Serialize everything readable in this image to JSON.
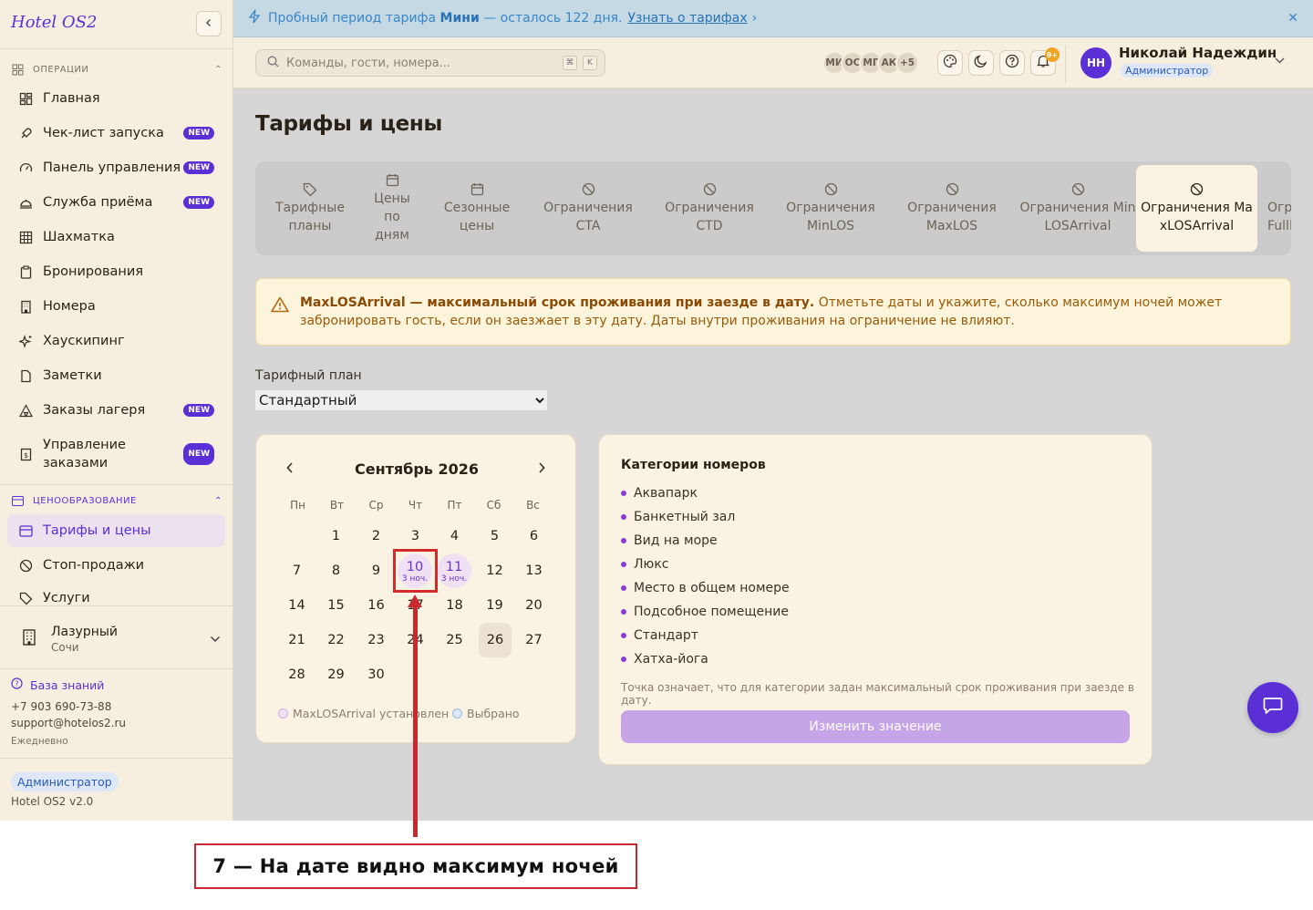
{
  "sidebar": {
    "logo": "Hotel OS2",
    "sections": {
      "operations": "ОПЕРАЦИИ",
      "pricing": "ЦЕНООБРАЗОВАНИЕ"
    },
    "items": [
      {
        "label": "Главная"
      },
      {
        "label": "Чек-лист запуска",
        "badge": "NEW"
      },
      {
        "label": "Панель управления",
        "badge": "NEW"
      },
      {
        "label": "Служба приёма",
        "badge": "NEW"
      },
      {
        "label": "Шахматка"
      },
      {
        "label": "Бронирования"
      },
      {
        "label": "Номера"
      },
      {
        "label": "Хаускипинг"
      },
      {
        "label": "Заметки"
      },
      {
        "label": "Заказы лагеря",
        "badge": "NEW"
      },
      {
        "label": "Управление заказами",
        "badge": "NEW"
      }
    ],
    "pricing_items": [
      {
        "label": "Тарифы и цены"
      },
      {
        "label": "Стоп-продажи"
      },
      {
        "label": "Услуги"
      }
    ],
    "hotel": {
      "name": "Лазурный",
      "city": "Сочи"
    },
    "kb": "База знаний",
    "phone": "+7 903 690-73-88",
    "email": "support@hotelos2.ru",
    "hours": "Ежедневно",
    "role": "Администратор",
    "version": "Hotel OS2 v2.0"
  },
  "banner": {
    "text_pre": "Пробный период тарифа",
    "plan": "Мини",
    "text_post": "— осталось 122 дня.",
    "link": "Узнать о тарифах",
    "link_arrow": "›",
    "close": "✕"
  },
  "topbar": {
    "search_placeholder": "Команды, гости, номера...",
    "kbd1": "⌘",
    "kbd2": "K",
    "avatars": [
      "МИ",
      "ОС",
      "МГ",
      "АК",
      "+5"
    ],
    "notif_count": "9+",
    "user_initials": "НН",
    "user_name": "Николай Надеждин",
    "user_role": "Администратор"
  },
  "page": {
    "title": "Тарифы и цены",
    "tabs": [
      {
        "label": "Тарифные планы"
      },
      {
        "label": "Цены по дням"
      },
      {
        "label": "Сезонные цены"
      },
      {
        "label": "Ограничения CTA"
      },
      {
        "label": "Ограничения CTD"
      },
      {
        "label": "Ограничения MinLOS"
      },
      {
        "label": "Ограничения MaxLOS"
      },
      {
        "label": "Ограничения MinLOSArrival"
      },
      {
        "label": "Ограничения MaxLOSArrival"
      },
      {
        "label": "Ограничения FullPa"
      }
    ],
    "alert_bold": "MaxLOSArrival — максимальный срок проживания при заезде в дату.",
    "alert_text": "Отметьте даты и укажите, сколько максимум ночей может забронировать гость, если он заезжает в эту дату. Даты внутри проживания на ограничение не влияют.",
    "plan_label": "Тарифный план",
    "plan_value": "Стандартный"
  },
  "calendar": {
    "month": "Сентябрь 2026",
    "prev": "‹",
    "next": "›",
    "dow": [
      "Пн",
      "Вт",
      "Ср",
      "Чт",
      "Пт",
      "Сб",
      "Вс"
    ],
    "first_weekday_index": 1,
    "days_in_month": 30,
    "today": 26,
    "restricted": [
      {
        "day": 10,
        "label": "3 ноч."
      },
      {
        "day": 11,
        "label": "3 ноч."
      }
    ],
    "legend_set": "MaxLOSArrival установлен",
    "legend_selected": "Выбрано"
  },
  "categories": {
    "title": "Категории номеров",
    "items": [
      "Аквапарк",
      "Банкетный зал",
      "Вид на море",
      "Люкс",
      "Место в общем номере",
      "Подсобное помещение",
      "Стандарт",
      "Хатха-йога"
    ],
    "note": "Точка означает, что для категории задан максимальный срок проживания при заезде в дату.",
    "button": "Изменить значение"
  },
  "annotation": {
    "label": "7 — На дате видно максимум ночей"
  },
  "colors": {
    "accent": "#5b2fd6",
    "sidebar_bg": "#f6efe0",
    "annotation": "#c8282e"
  }
}
